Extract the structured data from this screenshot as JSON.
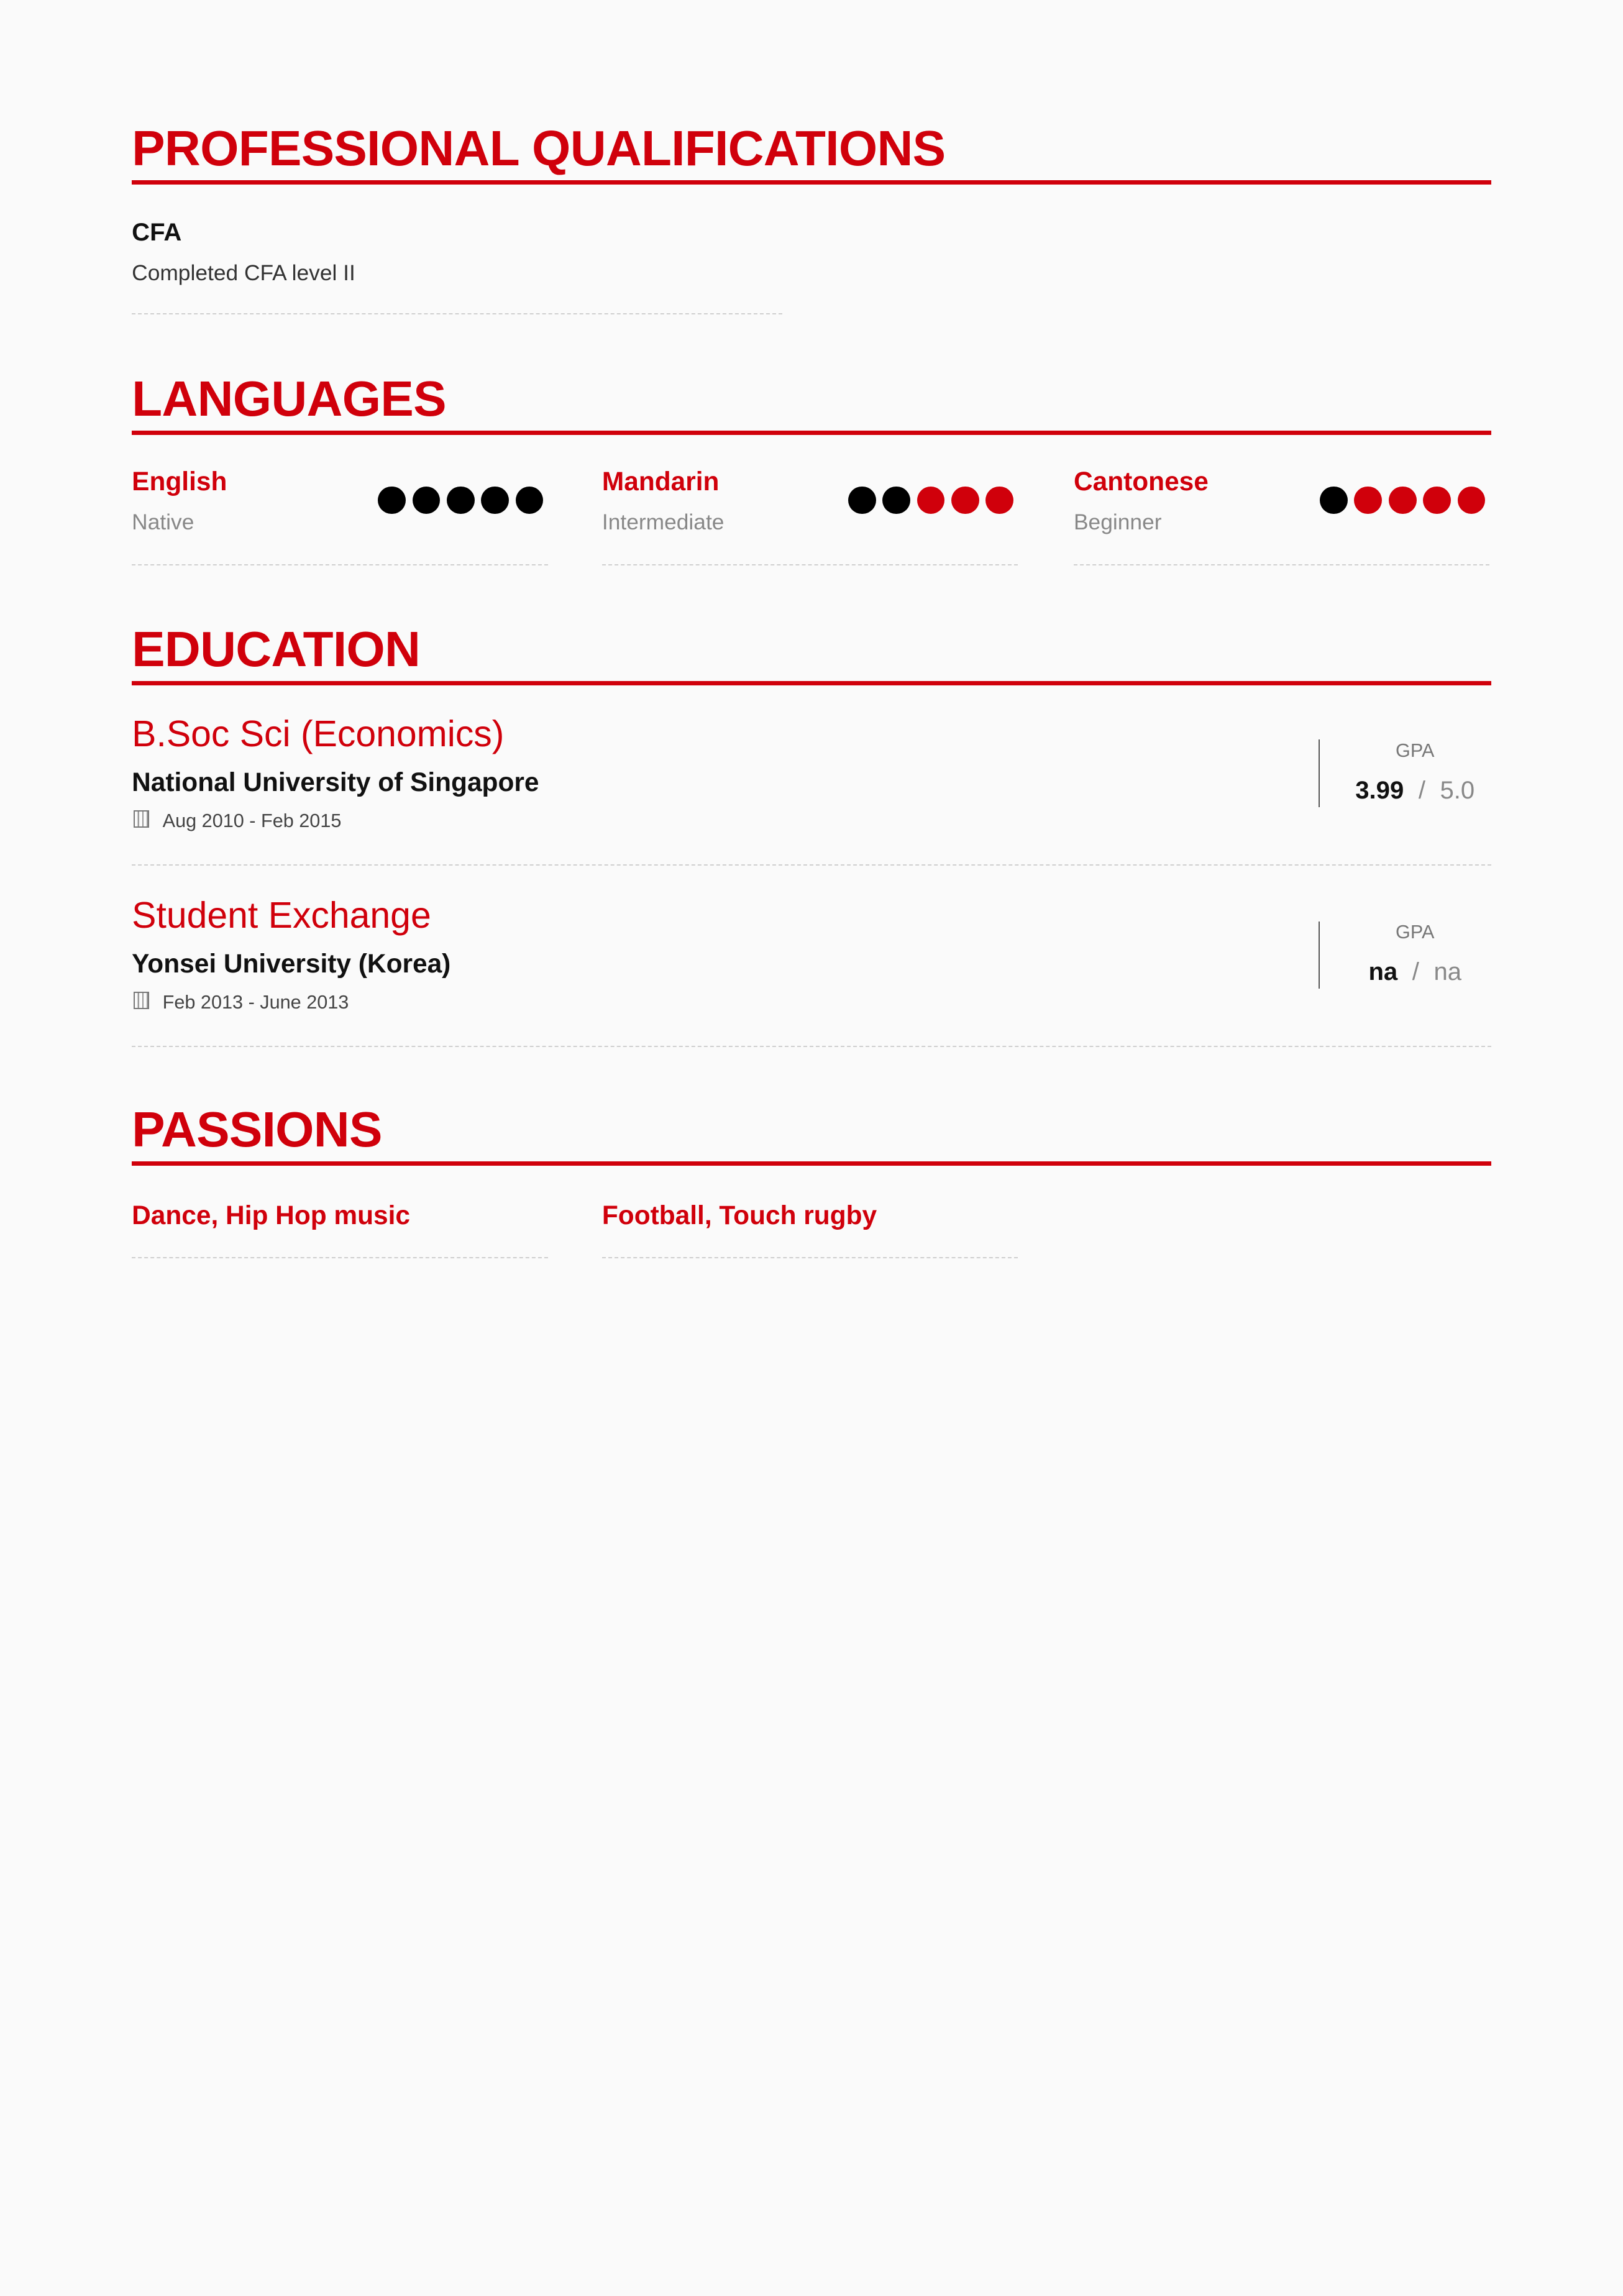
{
  "colors": {
    "accent": "#d0000b",
    "dot_filled": "#000000",
    "dot_empty": "#d0000b"
  },
  "qualifications": {
    "heading": "PROFESSIONAL QUALIFICATIONS",
    "items": [
      {
        "title": "CFA",
        "description": "Completed CFA level II"
      }
    ]
  },
  "languages": {
    "heading": "LANGUAGES",
    "items": [
      {
        "name": "English",
        "level": "Native",
        "rating": 5,
        "max": 5
      },
      {
        "name": "Mandarin",
        "level": "Intermediate",
        "rating": 2,
        "max": 5
      },
      {
        "name": "Cantonese",
        "level": "Beginner",
        "rating": 1,
        "max": 5
      }
    ]
  },
  "education": {
    "heading": "EDUCATION",
    "items": [
      {
        "degree": "B.Soc Sci (Economics)",
        "school": "National University of Singapore",
        "dates": "Aug 2010 - Feb 2015",
        "date_icon": "calendar-icon",
        "gpa_label": "GPA",
        "gpa": "3.99",
        "gpa_sep": "/",
        "gpa_max": "5.0"
      },
      {
        "degree": "Student Exchange",
        "school": "Yonsei University (Korea)",
        "dates": "Feb 2013 - June 2013",
        "date_icon": "calendar-icon",
        "gpa_label": "GPA",
        "gpa": "na",
        "gpa_sep": "/",
        "gpa_max": "na"
      }
    ]
  },
  "passions": {
    "heading": "PASSIONS",
    "items": [
      {
        "title": "Dance, Hip Hop music"
      },
      {
        "title": "Football, Touch rugby"
      }
    ]
  }
}
